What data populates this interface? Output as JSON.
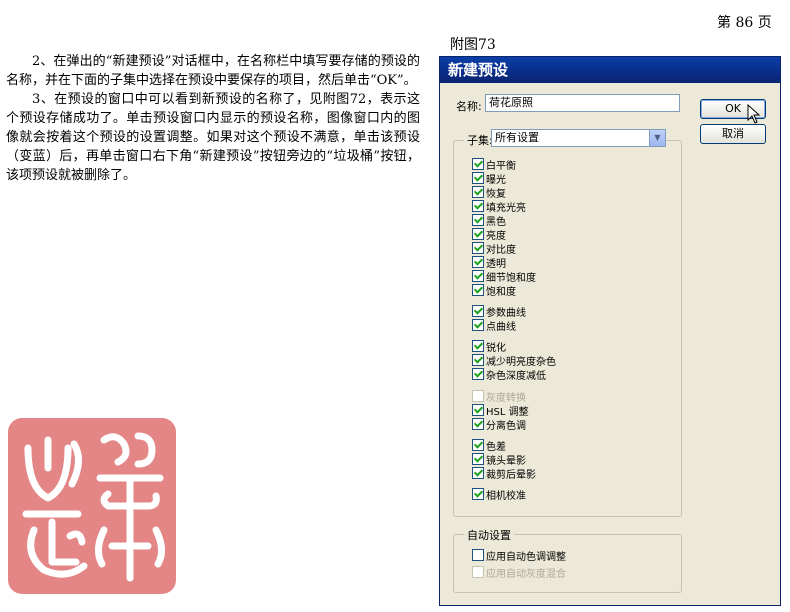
{
  "page_number": "第 86 页",
  "figure_caption": "附图73",
  "paragraphs": [
    "2、在弹出的“新建预设”对话框中，在名称栏中填写要存储的预设的名称，并在下面的子集中选择在预设中要保存的项目，然后单击“OK”。",
    "3、在预设的窗口中可以看到新预设的名称了，见附图72，表示这个预设存储成功了。单击预设窗口内显示的预设名称，图像窗口内的图像就会按着这个预设的设置调整。如果对这个预设不满意，单击该预设（变蓝）后，再单击窗口右下角“新建预设”按钮旁边的“垃圾桶”按钮，该项预设就被删除了。"
  ],
  "seal": {
    "color": "#e07777",
    "text": ""
  },
  "dialog": {
    "title": "新建预设",
    "name_label": "名称:",
    "name_value": "荷花原照",
    "ok_label": "OK",
    "cancel_label": "取消",
    "subset_label": "子集:",
    "subset_value": "所有设置",
    "subset_items": [
      {
        "label": "白平衡",
        "checked": true,
        "disabled": false
      },
      {
        "label": "曝光",
        "checked": true,
        "disabled": false
      },
      {
        "label": "恢复",
        "checked": true,
        "disabled": false
      },
      {
        "label": "填充光亮",
        "checked": true,
        "disabled": false
      },
      {
        "label": "黑色",
        "checked": true,
        "disabled": false
      },
      {
        "label": "亮度",
        "checked": true,
        "disabled": false
      },
      {
        "label": "对比度",
        "checked": true,
        "disabled": false
      },
      {
        "label": "透明",
        "checked": true,
        "disabled": false
      },
      {
        "label": "细节饱和度",
        "checked": true,
        "disabled": false
      },
      {
        "label": "饱和度",
        "checked": true,
        "disabled": false
      },
      {
        "label": "参数曲线",
        "checked": true,
        "disabled": false
      },
      {
        "label": "点曲线",
        "checked": true,
        "disabled": false
      },
      {
        "label": "锐化",
        "checked": true,
        "disabled": false
      },
      {
        "label": "减少明亮度杂色",
        "checked": true,
        "disabled": false
      },
      {
        "label": "杂色深度减低",
        "checked": true,
        "disabled": false
      },
      {
        "label": "灰度转换",
        "checked": false,
        "disabled": true
      },
      {
        "label": "HSL 调整",
        "checked": true,
        "disabled": false
      },
      {
        "label": "分离色调",
        "checked": true,
        "disabled": false
      },
      {
        "label": "色差",
        "checked": true,
        "disabled": false
      },
      {
        "label": "镜头晕影",
        "checked": true,
        "disabled": false
      },
      {
        "label": "裁剪后晕影",
        "checked": true,
        "disabled": false
      },
      {
        "label": "相机校准",
        "checked": true,
        "disabled": false
      }
    ],
    "auto_label": "自动设置",
    "auto_items": [
      {
        "label": "应用自动色调调整",
        "checked": false,
        "disabled": false
      },
      {
        "label": "应用自动灰度混合",
        "checked": false,
        "disabled": true
      }
    ]
  }
}
